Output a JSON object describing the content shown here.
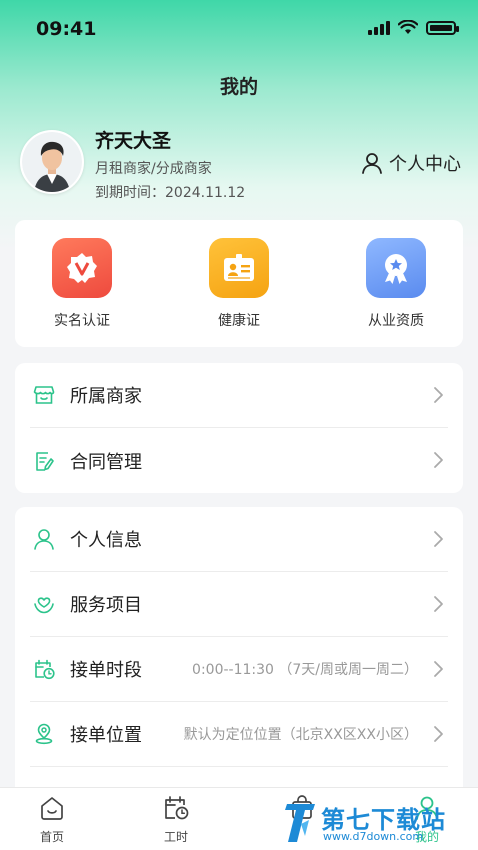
{
  "status": {
    "time": "09:41"
  },
  "header": {
    "title": "我的"
  },
  "profile": {
    "name": "齐天大圣",
    "type": "月租商家/分成商家",
    "expire": "到期时间：2024.11.12",
    "personal_center": "个人中心"
  },
  "certs": [
    {
      "label": "实名认证",
      "icon": "verified-badge-icon",
      "color": "#f25a4d"
    },
    {
      "label": "健康证",
      "icon": "id-card-icon",
      "color": "#f9a91c"
    },
    {
      "label": "从业资质",
      "icon": "award-ribbon-icon",
      "color": "#6d9ff5"
    }
  ],
  "menu_group1": [
    {
      "label": "所属商家",
      "icon": "store-icon"
    },
    {
      "label": "合同管理",
      "icon": "contract-icon"
    }
  ],
  "menu_group2": [
    {
      "label": "个人信息",
      "icon": "person-icon",
      "value": ""
    },
    {
      "label": "服务项目",
      "icon": "heart-hands-icon",
      "value": ""
    },
    {
      "label": "接单时段",
      "icon": "calendar-clock-icon",
      "value": "0:00--11:30 （7天/周或周一周二）"
    },
    {
      "label": "接单位置",
      "icon": "location-pin-icon",
      "value": "默认为定位位置（北京XX区XX小区）"
    }
  ],
  "tabs": [
    {
      "label": "首页",
      "icon": "home-icon"
    },
    {
      "label": "工时",
      "icon": "calendar-clock-icon"
    },
    {
      "label": "",
      "icon": "bag-icon"
    },
    {
      "label": "我的",
      "icon": "user-icon"
    }
  ],
  "watermark": {
    "text": "第七下载站",
    "url": "www.d7down.com"
  },
  "colors": {
    "accent": "#2cc38b",
    "brand_gradient_top": "#3fd7a8"
  }
}
